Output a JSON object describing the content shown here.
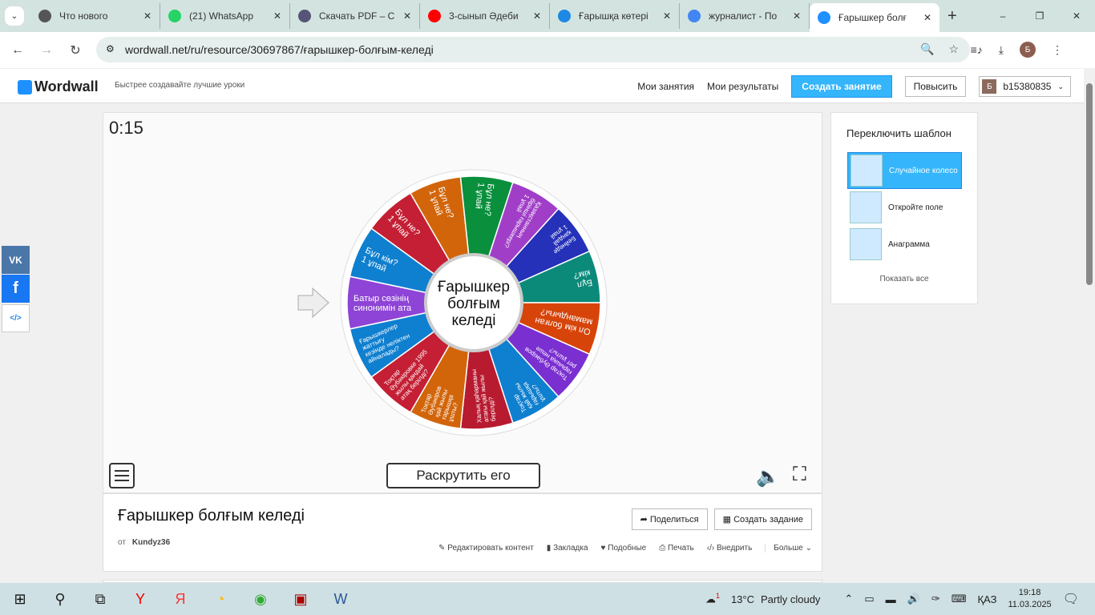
{
  "browser": {
    "tabs": [
      {
        "title": "Что нового",
        "icon": "chrome-icon",
        "color": "#555"
      },
      {
        "title": "(21) WhatsApp",
        "icon": "whatsapp-icon",
        "color": "#25d366"
      },
      {
        "title": "Скачать PDF – С",
        "icon": "books-icon",
        "color": "#557"
      },
      {
        "title": "3-сынып Әдеби",
        "icon": "youtube-icon",
        "color": "#ff0000"
      },
      {
        "title": "Ғарышқа көтері",
        "icon": "wordwall-icon",
        "color": "#1e88e5"
      },
      {
        "title": "журналист - По",
        "icon": "google-icon",
        "color": "#4285f4"
      },
      {
        "title": "Ғарышкер болғ",
        "icon": "wordwall-icon",
        "color": "#1e90ff"
      }
    ],
    "url": "wordwall.net/ru/resource/30697867/ғарышкер-болғым-келеді",
    "profile_initial": "Б"
  },
  "site": {
    "logo": "Wordwall",
    "slogan": "Быстрее создавайте лучшие уроки",
    "nav": [
      "Мои занятия",
      "Мои результаты"
    ],
    "create_label": "Создать занятие",
    "upgrade_label": "Повысить",
    "user_initial": "Б",
    "username": "b15380835"
  },
  "game": {
    "timer": "0:15",
    "center_text": [
      "Ғарышкер",
      "болғым",
      "келеді"
    ],
    "spin_label": "Раскрутить его",
    "segments": [
      {
        "label": "Батыр сөзінің\nсинонимін ата",
        "color": "#8e44d6"
      },
      {
        "label": "Бұл кім?\n1 ұпай",
        "color": "#0f7fcf"
      },
      {
        "label": "Бұл не?\n1 ұпай",
        "color": "#c41f34"
      },
      {
        "label": "Бұл не?\n1 ұпай",
        "color": "#d2650a"
      },
      {
        "label": "Бұл не?\n1 ұпай",
        "color": "#0a8f3c"
      },
      {
        "label": "Қазақстанның\nбірінші ғарышкері?\n1 ұпай",
        "color": "#a13ec8"
      },
      {
        "label": "Бейнеде\nқандай\n1 ұпай",
        "color": "#2431b8"
      },
      {
        "label": "Бұл\nкім?",
        "color": "#0b8a7a"
      },
      {
        "label": "Ол кім болған\nмамандығы?",
        "color": "#d6440a"
      },
      {
        "label": "Тоқтар Әубәкіров\nғарышқа неше\nрет ұшты?",
        "color": "#7a2fd0"
      },
      {
        "label": "Тоқтар\nқай жылы\nғарышқа\nұшты?",
        "color": "#0f7fcf"
      },
      {
        "label": "Халық қаһарманы\nатағы қай жылы\nберілді?",
        "color": "#b81a30"
      },
      {
        "label": "Тоқтар\nӘубәкіров\nқай жылы\nғарышқа\nұшты?",
        "color": "#d2650a"
      },
      {
        "label": "Тоқтар\nӘубәкіровке 1995\nжылы қандай\nатақ берілді?",
        "color": "#c41f34"
      },
      {
        "label": "Ғарышкерлер\nжаттығу\nкезінде неліктен\nайналады?",
        "color": "#0f7fcf"
      }
    ]
  },
  "info": {
    "title": "Ғарышкер болғым келеді",
    "by_label": "от",
    "author": "Kundyz36",
    "share_label": "Поделиться",
    "assign_label": "Создать задание",
    "actions": [
      "Редактировать контент",
      "Закладка",
      "Подобные",
      "Печать",
      "Внедрить",
      "Больше"
    ]
  },
  "sidebar": {
    "title": "Переключить шаблон",
    "templates": [
      "Случайное колесо",
      "Откройте поле",
      "Анаграмма"
    ],
    "show_all": "Показать все"
  },
  "social": [
    "VK",
    "f",
    "</>"
  ],
  "taskbar": {
    "weather_temp": "13°C",
    "weather_text": "Partly cloudy",
    "weather_badge": "1",
    "lang": "ҚАЗ",
    "time": "19:18",
    "date": "11.03.2025"
  }
}
